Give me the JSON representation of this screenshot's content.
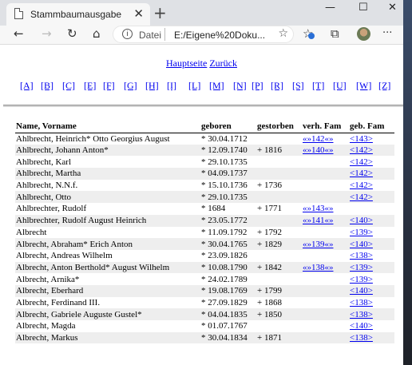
{
  "browser": {
    "tab_title": "Stammbaumausgabe",
    "tab_close": "✕",
    "new_tab": "+",
    "win_minimize": "—",
    "win_maximize": "☐",
    "win_close": "✕",
    "back": "←",
    "forward": "→",
    "reload": "↻",
    "home": "⌂",
    "info": "i",
    "scheme": "Datei",
    "url": "E:/Eigene%20Doku...",
    "star": "☆",
    "favorites": "☆",
    "collections": "⧉",
    "menu": "···"
  },
  "page": {
    "main_link": "Hauptseite",
    "back_link": "Zurück",
    "letters": [
      "[A]",
      "[B]",
      "[C]",
      "[E]",
      "[F]",
      "[G]",
      "[H]",
      "[I]",
      "[L]",
      "[M]",
      "[N]",
      "[P]",
      "[R]",
      "[S]",
      "[T]",
      "[U]",
      "[W]",
      "[Z]"
    ],
    "headers": [
      "Name, Vorname",
      "geboren",
      "gestorben",
      "verh. Fam",
      "geb. Fam"
    ],
    "rows": [
      [
        "Ahlbrecht, Heinrich* Otto Georgius August",
        "* 30.04.1712",
        "",
        "«»142«»",
        "<143>"
      ],
      [
        "Ahlbrecht, Johann Anton*",
        "* 12.09.1740",
        "+ 1816",
        "«»140«»",
        "<142>"
      ],
      [
        "Ahlbrecht, Karl",
        "* 29.10.1735",
        "",
        "",
        "<142>"
      ],
      [
        "Ahlbrecht, Martha",
        "* 04.09.1737",
        "",
        "",
        "<142>"
      ],
      [
        "Ahlbrecht, N.N.f.",
        "* 15.10.1736",
        "+ 1736",
        "",
        "<142>"
      ],
      [
        "Ahlbrecht, Otto",
        "* 29.10.1735",
        "",
        "",
        "<142>"
      ],
      [
        "Ahlbrechter, Rudolf",
        "* 1684",
        "+ 1771",
        "«»143«»",
        ""
      ],
      [
        "Ahlbrechter, Rudolf August Heinrich",
        "* 23.05.1772",
        "",
        "«»141«»",
        "<140>"
      ],
      [
        "Albrecht",
        "* 11.09.1792",
        "+ 1792",
        "",
        "<139>"
      ],
      [
        "Albrecht, Abraham* Erich Anton",
        "* 30.04.1765",
        "+ 1829",
        "«»139«»",
        "<140>"
      ],
      [
        "Albrecht, Andreas Wilhelm",
        "* 23.09.1826",
        "",
        "",
        "<138>"
      ],
      [
        "Albrecht, Anton Berthold* August Wilhelm",
        "* 10.08.1790",
        "+ 1842",
        "«»138«»",
        "<139>"
      ],
      [
        "Albrecht, Arnika*",
        "* 24.02.1789",
        "",
        "",
        "<139>"
      ],
      [
        "Albrecht, Eberhard",
        "* 19.08.1769",
        "+ 1799",
        "",
        "<140>"
      ],
      [
        "Albrecht, Ferdinand III.",
        "* 27.09.1829",
        "+ 1868",
        "",
        "<138>"
      ],
      [
        "Albrecht, Gabriele Auguste Gustel*",
        "* 04.04.1835",
        "+ 1850",
        "",
        "<138>"
      ],
      [
        "Albrecht, Magda",
        "* 01.07.1767",
        "",
        "",
        "<140>"
      ],
      [
        "Albrecht, Markus",
        "* 30.04.1834",
        "+ 1871",
        "",
        "<138>"
      ]
    ]
  }
}
